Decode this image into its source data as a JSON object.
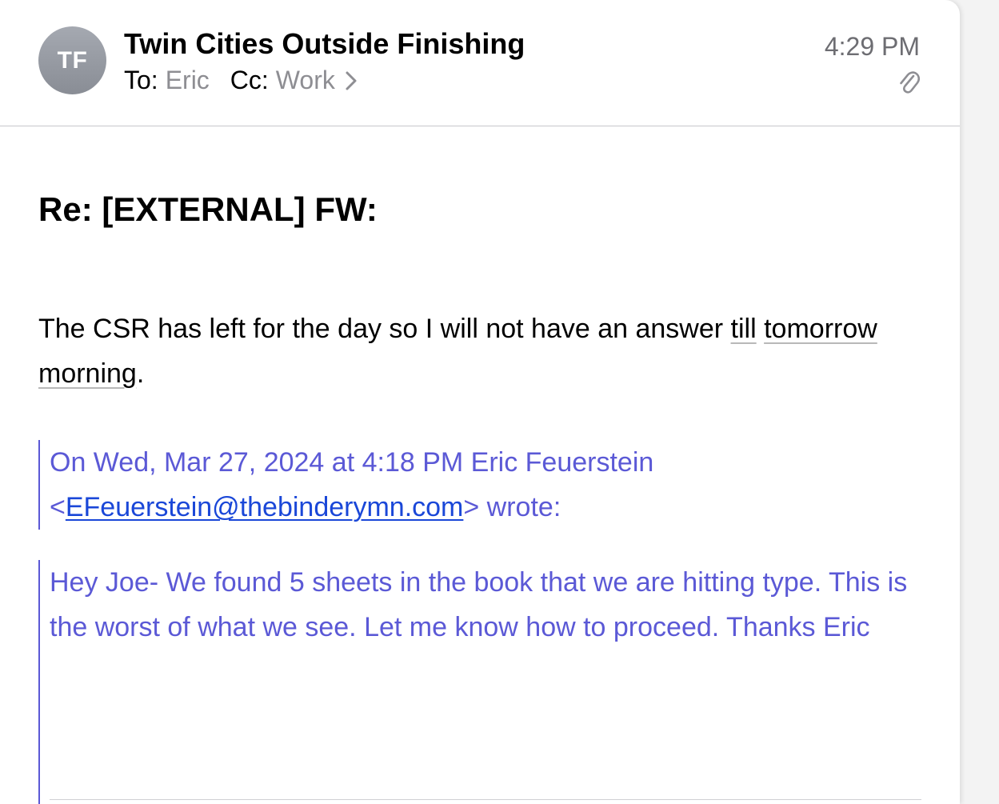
{
  "header": {
    "avatar_initials": "TF",
    "sender_name": "Twin Cities Outside Finishing",
    "to_label": "To:",
    "to_value": "Eric",
    "cc_label": "Cc:",
    "cc_value": "Work",
    "time": "4:29 PM",
    "icons": [
      "chevron-right-icon",
      "paperclip-icon"
    ]
  },
  "subject": "Re: [EXTERNAL] FW:",
  "message": {
    "text_before": "The CSR has left for the day so I will not have an answer ",
    "text_underlined_1": "till",
    "text_between": " ",
    "text_underlined_2": "tomorrow morning",
    "text_after": "."
  },
  "quote": {
    "attribution_prefix": "On Wed, Mar 27, 2024 at 4:18 PM Eric Feuerstein <",
    "email": "EFeuerstein@thebinderymn.com",
    "attribution_suffix": "> wrote:",
    "body": "Hey Joe- We found 5 sheets in the book that we are hitting type.  This is the worst of what we see.  Let me know how to proceed.  Thanks Eric"
  },
  "colors": {
    "quote_text": "#5b59d6",
    "link": "#1a47d8",
    "secondary_text": "#8e8e93",
    "avatar_bg": "#979ba3"
  }
}
